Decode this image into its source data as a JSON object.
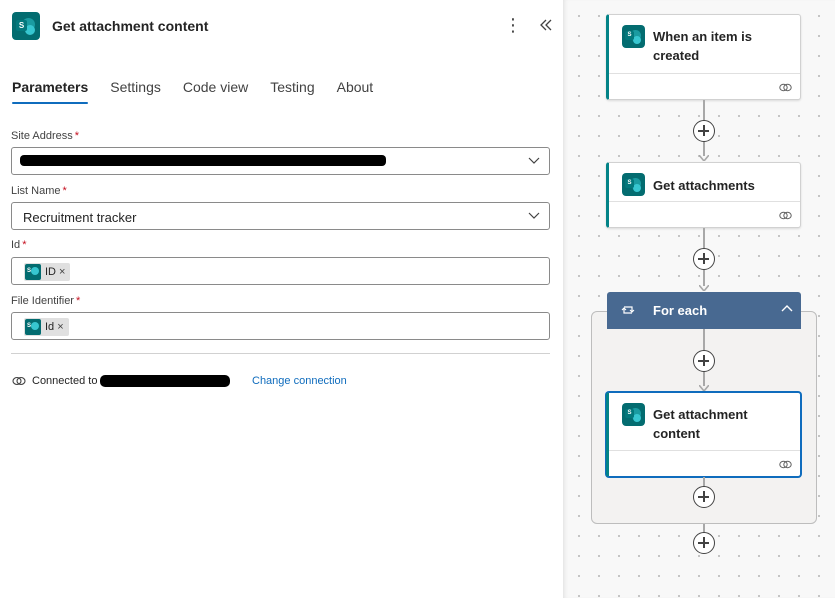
{
  "panel": {
    "title": "Get attachment content",
    "more_icon": "more-vertical-icon",
    "collapse_icon": "double-chevron-left-icon"
  },
  "tabs": [
    {
      "label": "Parameters",
      "active": true
    },
    {
      "label": "Settings",
      "active": false
    },
    {
      "label": "Code view",
      "active": false
    },
    {
      "label": "Testing",
      "active": false
    },
    {
      "label": "About",
      "active": false
    }
  ],
  "fields": {
    "site_address": {
      "label": "Site Address",
      "required": "*",
      "value": ""
    },
    "list_name": {
      "label": "List Name",
      "required": "*",
      "value": "Recruitment tracker"
    },
    "id": {
      "label": "Id",
      "required": "*",
      "token": "ID",
      "token_remove": "×"
    },
    "file_identifier": {
      "label": "File Identifier",
      "required": "*",
      "token": "Id",
      "token_remove": "×"
    }
  },
  "connection": {
    "prefix": "Connected to",
    "change_link": "Change connection"
  },
  "flow": {
    "trigger": {
      "title": "When an item is created"
    },
    "step2": {
      "title": "Get attachments"
    },
    "foreach": {
      "title": "For each"
    },
    "step3": {
      "title": "Get attachment content"
    }
  },
  "colors": {
    "accent": "#0f6cbd",
    "sharepoint": "#036c70",
    "foreach_header": "#486991",
    "required": "#c50f1f"
  }
}
